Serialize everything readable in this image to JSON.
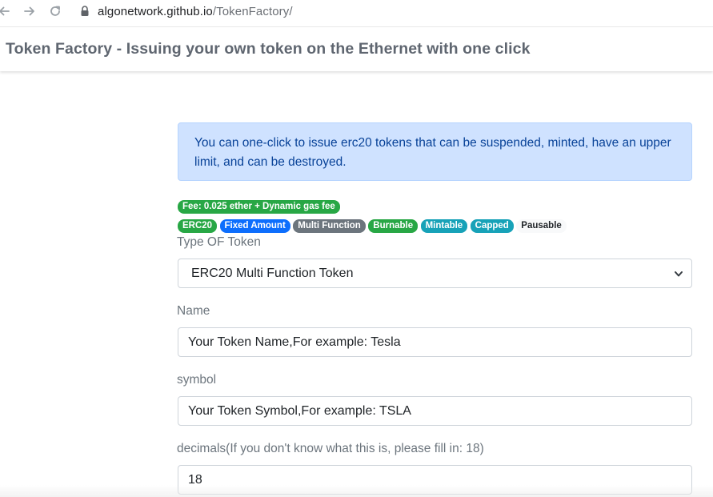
{
  "browser": {
    "url_host": "algonetwork.github.io",
    "url_path": "/TokenFactory/"
  },
  "navbar": {
    "title": "Token Factory - Issuing your own token on the Ethernet with one click"
  },
  "alert": {
    "text": "You can one-click to issue erc20 tokens that can be suspended, minted, have an upper limit, and can be destroyed."
  },
  "fee_badge": "Fee: 0.025 ether + Dynamic gas fee",
  "feature_badges": [
    {
      "label": "ERC20",
      "color": "#28a745"
    },
    {
      "label": "Fixed Amount",
      "color": "#0d6efd"
    },
    {
      "label": "Multi Function",
      "color": "#6c757d"
    },
    {
      "label": "Burnable",
      "color": "#28a745"
    },
    {
      "label": "Mintable",
      "color": "#17a2b8"
    },
    {
      "label": "Capped",
      "color": "#17a2b8"
    },
    {
      "label": "Pausable",
      "color": "#f8f9fa"
    }
  ],
  "form": {
    "type_label": "Type OF Token",
    "type_selected": "ERC20 Multi Function Token",
    "name_label": "Name",
    "name_placeholder": "Your Token Name,For example: Tesla",
    "symbol_label": "symbol",
    "symbol_placeholder": "Your Token Symbol,For example: TSLA",
    "decimals_label": "decimals(If you don't know what this is, please fill in: 18)",
    "decimals_value": "18"
  },
  "icons": {
    "back": "arrow-left-icon",
    "forward": "arrow-right-icon",
    "reload": "reload-icon",
    "lock": "lock-icon",
    "select_arrow": "chevron-down-icon"
  }
}
